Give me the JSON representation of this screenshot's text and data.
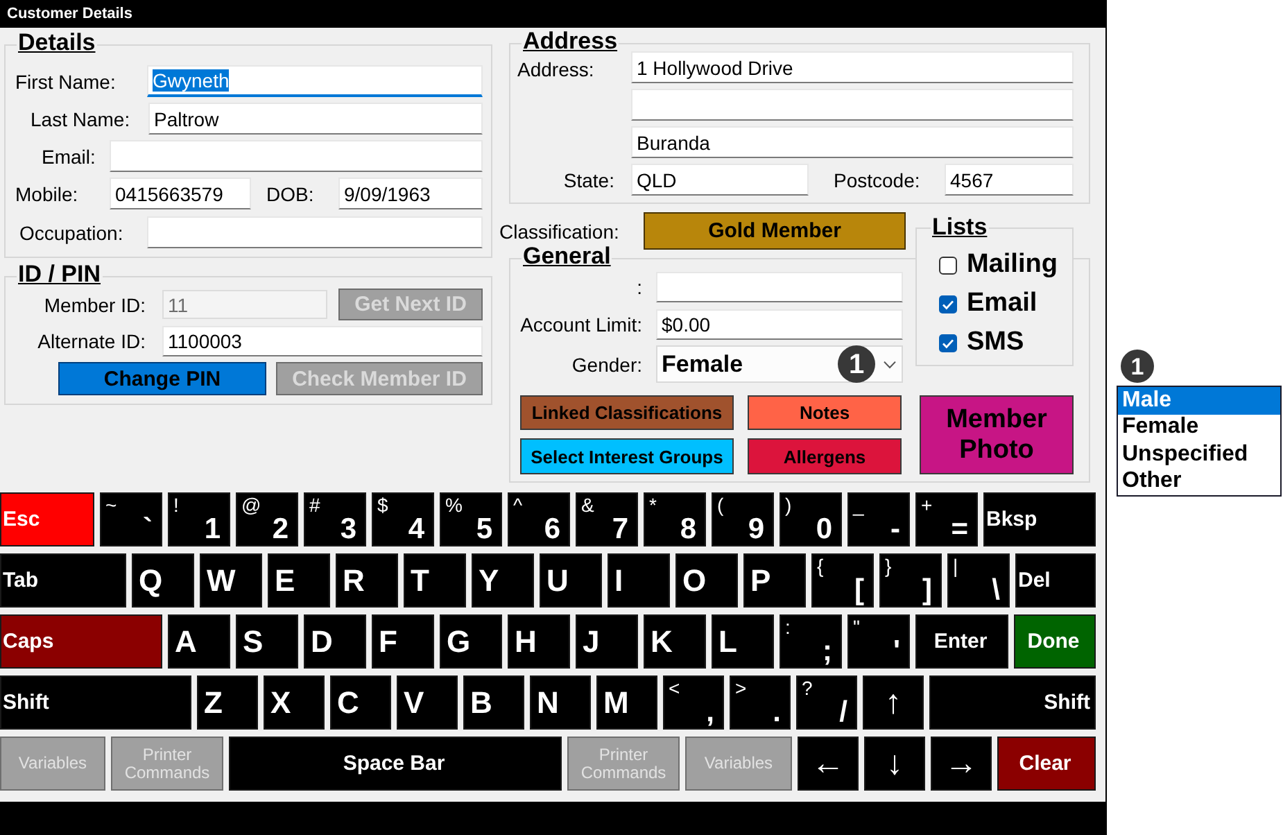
{
  "window": {
    "title": "Customer Details"
  },
  "details": {
    "title": "Details",
    "rows": [
      {
        "fields": [
          {
            "label": "First Name:",
            "value": "Gwyneth",
            "focused": true
          }
        ]
      },
      {
        "fields": [
          {
            "label": "Last Name:",
            "value": "Paltrow",
            "focused": false
          }
        ]
      },
      {
        "fields": [
          {
            "label": "Email:",
            "focused": false
          }
        ]
      },
      {
        "fields": [
          {
            "label": "Mobile:",
            "value": "0415663579",
            "focused": false
          },
          {
            "label": "DOB:",
            "value": "9/09/1963",
            "focused": false
          }
        ]
      },
      {
        "fields": [
          {
            "label": "Occupation:",
            "focused": false
          }
        ]
      }
    ]
  },
  "id_pin": {
    "title": "ID / PIN",
    "rows": [
      {
        "label": "Member ID:",
        "value": "11",
        "disabled": true,
        "button": {
          "label": "Get Next ID",
          "disabled": true
        }
      },
      {
        "label": "Alternate ID:",
        "value": "1100003",
        "disabled": false
      }
    ],
    "buttons": [
      {
        "label": "Change PIN",
        "disabled": false
      },
      {
        "label": "Check Member ID",
        "disabled": true
      }
    ]
  },
  "address": {
    "title": "Address",
    "label": "Address:",
    "line_1": "1 Hollywood Drive",
    "line_3": "Buranda",
    "state": {
      "label": "State:",
      "value": "QLD"
    },
    "postcode": {
      "label": "Postcode:",
      "value": "4567"
    }
  },
  "classification": {
    "label": "Classification:",
    "value": "Gold Member",
    "color": "#b8860b"
  },
  "general": {
    "title": "General",
    "fields": [
      {
        "kind": "text",
        "label": ":"
      },
      {
        "kind": "text",
        "label": "Account Limit:",
        "value": "$0.00"
      },
      {
        "kind": "select",
        "label": "Gender:",
        "value": "Female",
        "badge": "1"
      }
    ],
    "buttons": [
      {
        "kind": "small",
        "label": "Linked Classifications",
        "color": "#a0522d"
      },
      {
        "kind": "small",
        "label": "Notes",
        "color": "#ff6347"
      },
      {
        "kind": "tall",
        "label": "Member Photo",
        "color": "#c71585"
      },
      {
        "kind": "small",
        "label": "Select Interest Groups",
        "color": "#00bfff"
      },
      {
        "kind": "small",
        "label": "Allergens",
        "color": "#dc143c"
      }
    ]
  },
  "lists": {
    "title": "Lists",
    "items": [
      {
        "label": "Mailing",
        "checked": false
      },
      {
        "label": "Email",
        "checked": true
      },
      {
        "label": "SMS",
        "checked": true
      }
    ]
  },
  "gender_popup": {
    "badge": "1",
    "options": [
      {
        "label": "Male",
        "selected": true
      },
      {
        "label": "Female",
        "selected": false
      },
      {
        "label": "Unspecified",
        "selected": false
      },
      {
        "label": "Other",
        "selected": false
      }
    ]
  },
  "keyboard": {
    "rows": [
      {
        "keys": [
          {
            "kind": "action",
            "label": "Esc",
            "color": "#ff0000"
          },
          {
            "kind": "pair",
            "shift": "~",
            "base": "`"
          },
          {
            "kind": "pair",
            "shift": "!",
            "base": "1"
          },
          {
            "kind": "pair",
            "shift": "@",
            "base": "2"
          },
          {
            "kind": "pair",
            "shift": "#",
            "base": "3"
          },
          {
            "kind": "pair",
            "shift": "$",
            "base": "4"
          },
          {
            "kind": "pair",
            "shift": "%",
            "base": "5"
          },
          {
            "kind": "pair",
            "shift": "^",
            "base": "6"
          },
          {
            "kind": "pair",
            "shift": "&",
            "base": "7"
          },
          {
            "kind": "pair",
            "shift": "*",
            "base": "8"
          },
          {
            "kind": "pair",
            "shift": "(",
            "base": "9"
          },
          {
            "kind": "pair",
            "shift": ")",
            "base": "0"
          },
          {
            "kind": "pair",
            "shift": "_",
            "base": "-"
          },
          {
            "kind": "pair",
            "shift": "+",
            "base": "="
          },
          {
            "kind": "action",
            "label": "Bksp"
          }
        ]
      },
      {
        "keys": [
          {
            "kind": "action",
            "label": "Tab"
          },
          {
            "kind": "char",
            "label": "Q"
          },
          {
            "kind": "char",
            "label": "W"
          },
          {
            "kind": "char",
            "label": "E"
          },
          {
            "kind": "char",
            "label": "R"
          },
          {
            "kind": "char",
            "label": "T"
          },
          {
            "kind": "char",
            "label": "Y"
          },
          {
            "kind": "char",
            "label": "U"
          },
          {
            "kind": "char",
            "label": "I"
          },
          {
            "kind": "char",
            "label": "O"
          },
          {
            "kind": "char",
            "label": "P"
          },
          {
            "kind": "pair",
            "shift": "{",
            "base": "["
          },
          {
            "kind": "pair",
            "shift": "}",
            "base": "]"
          },
          {
            "kind": "pair",
            "shift": "|",
            "base": "\\"
          },
          {
            "kind": "action",
            "label": "Del"
          }
        ]
      },
      {
        "keys": [
          {
            "kind": "action",
            "label": "Caps",
            "color": "#8b0000"
          },
          {
            "kind": "char",
            "label": "A"
          },
          {
            "kind": "char",
            "label": "S"
          },
          {
            "kind": "char",
            "label": "D"
          },
          {
            "kind": "char",
            "label": "F"
          },
          {
            "kind": "char",
            "label": "G"
          },
          {
            "kind": "char",
            "label": "H"
          },
          {
            "kind": "char",
            "label": "J"
          },
          {
            "kind": "char",
            "label": "K"
          },
          {
            "kind": "char",
            "label": "L"
          },
          {
            "kind": "pair",
            "shift": ":",
            "base": ";"
          },
          {
            "kind": "pair",
            "shift": "\"",
            "base": "'"
          },
          {
            "kind": "action",
            "label": "Enter"
          },
          {
            "kind": "action",
            "label": "Done",
            "color": "#006400"
          }
        ]
      },
      {
        "keys": [
          {
            "kind": "action",
            "label": "Shift"
          },
          {
            "kind": "char",
            "label": "Z"
          },
          {
            "kind": "char",
            "label": "X"
          },
          {
            "kind": "char",
            "label": "C"
          },
          {
            "kind": "char",
            "label": "V"
          },
          {
            "kind": "char",
            "label": "B"
          },
          {
            "kind": "char",
            "label": "N"
          },
          {
            "kind": "char",
            "label": "M"
          },
          {
            "kind": "pair",
            "shift": "<",
            "base": ","
          },
          {
            "kind": "pair",
            "shift": ">",
            "base": "."
          },
          {
            "kind": "pair",
            "shift": "?",
            "base": "/"
          },
          {
            "kind": "arrow",
            "label": "↑"
          },
          {
            "kind": "action",
            "label": "Shift"
          }
        ]
      },
      {
        "keys": [
          {
            "kind": "action",
            "label": "Variables",
            "disabled": true
          },
          {
            "kind": "action",
            "label": "Printer Commands",
            "disabled": true
          },
          {
            "kind": "action",
            "label": "Space Bar",
            "disabled": false
          },
          {
            "kind": "action",
            "label": "Printer Commands",
            "disabled": true
          },
          {
            "kind": "action",
            "label": "Variables",
            "disabled": true
          },
          {
            "kind": "arrow",
            "label": "←",
            "disabled": false
          },
          {
            "kind": "arrow",
            "label": "↓",
            "disabled": false
          },
          {
            "kind": "arrow",
            "label": "→",
            "disabled": false
          },
          {
            "kind": "action",
            "label": "Clear",
            "color": "#8b0000",
            "disabled": false
          }
        ]
      }
    ]
  }
}
